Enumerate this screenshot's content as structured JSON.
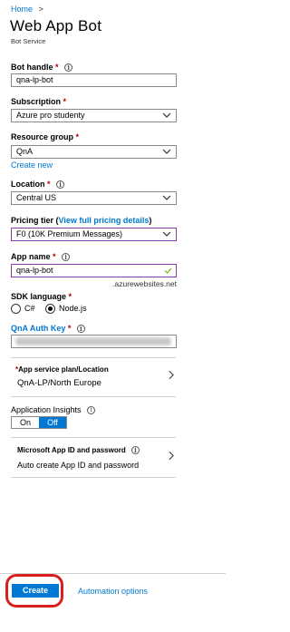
{
  "breadcrumb": {
    "home": "Home",
    "separator": ">"
  },
  "page": {
    "title": "Web App Bot",
    "subtitle": "Bot Service"
  },
  "bot_handle": {
    "label": "Bot handle",
    "required": "*",
    "value": "qna-lp-bot"
  },
  "subscription": {
    "label": "Subscription",
    "required": "*",
    "value": "Azure pro studenty"
  },
  "resource_group": {
    "label": "Resource group",
    "required": "*",
    "value": "QnA",
    "create_new": "Create new"
  },
  "location": {
    "label": "Location",
    "required": "*",
    "value": "Central US"
  },
  "pricing_tier": {
    "label_prefix": "Pricing tier (",
    "link": "View full pricing details",
    "label_suffix": ")",
    "value": "F0 (10K Premium Messages)"
  },
  "app_name": {
    "label": "App name",
    "required": "*",
    "value": "qna-lp-bot",
    "suffix": ".azurewebsites.net"
  },
  "sdk_language": {
    "label": "SDK language",
    "required": "*",
    "options": [
      "C#",
      "Node.js"
    ],
    "selected": "Node.js"
  },
  "qna_auth_key": {
    "label": "QnA Auth Key",
    "required": "*"
  },
  "app_service_plan": {
    "label_required": "*",
    "label": "App service plan/Location",
    "value": "QnA-LP/North Europe"
  },
  "app_insights": {
    "label": "Application Insights",
    "on": "On",
    "off": "Off",
    "selected": "Off"
  },
  "app_id": {
    "label": "Microsoft App ID and password",
    "value": "Auto create App ID and password"
  },
  "footer": {
    "create": "Create",
    "automation": "Automation options"
  },
  "colors": {
    "accent": "#0078d4",
    "required": "#a80000",
    "highlight_border": "#8c3aa6",
    "annotation": "#d91e1e",
    "check": "#6bb700"
  }
}
